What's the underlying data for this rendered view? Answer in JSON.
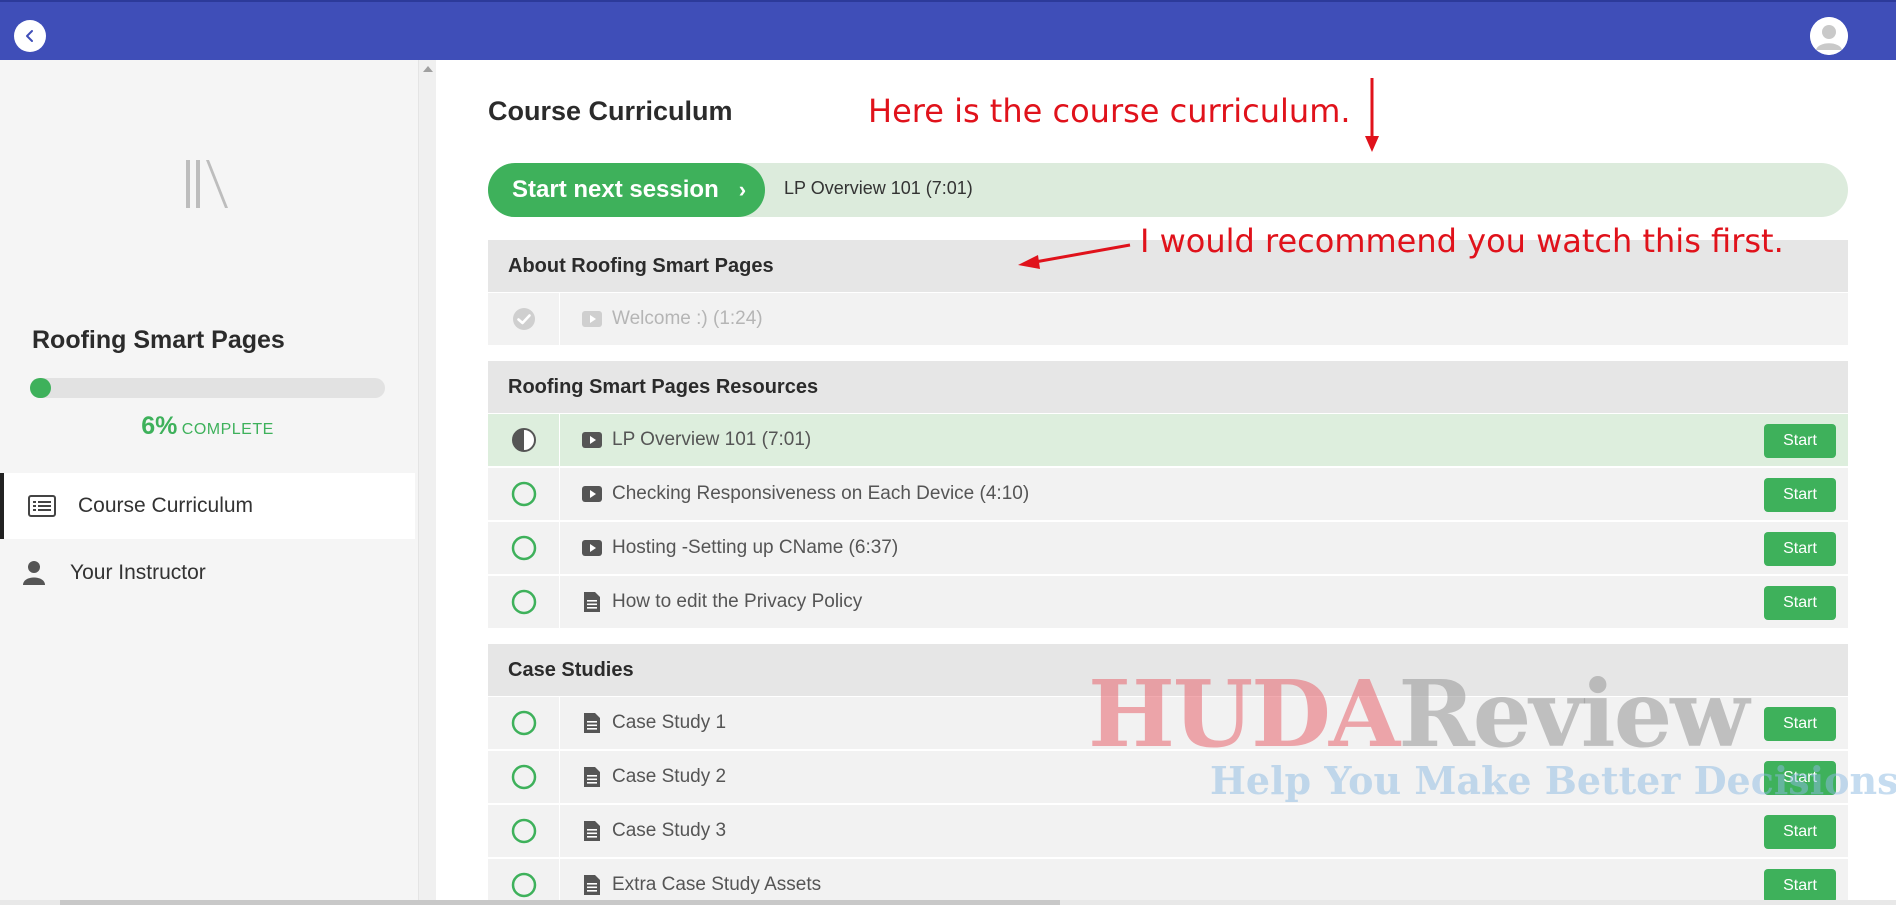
{
  "header": {
    "back_icon": "chevron-left-icon",
    "avatar_icon": "user-avatar-icon",
    "colors": {
      "bar": "#3f4eb8"
    }
  },
  "sidebar": {
    "logo_icon": "library-icon",
    "course_title": "Roofing Smart Pages",
    "progress": {
      "percent_label": "6%",
      "complete_label": "COMPLETE",
      "fraction": 0.06
    },
    "nav": [
      {
        "label": "Course Curriculum",
        "icon": "list-icon",
        "active": true
      },
      {
        "label": "Your Instructor",
        "icon": "person-icon",
        "active": false
      }
    ]
  },
  "main": {
    "title": "Course Curriculum",
    "next_session": {
      "button_label": "Start next session",
      "chevron": "›",
      "lesson": "LP Overview 101 (7:01)"
    },
    "sections": [
      {
        "title": "About Roofing Smart Pages",
        "lessons": [
          {
            "title": "Welcome :) (1:24)",
            "type": "video",
            "status": "completed",
            "button": ""
          }
        ]
      },
      {
        "title": "Roofing Smart Pages Resources",
        "lessons": [
          {
            "title": "LP Overview 101 (7:01)",
            "type": "video",
            "status": "in-progress",
            "button": "Start"
          },
          {
            "title": "Checking Responsiveness on Each Device (4:10)",
            "type": "video",
            "status": "not-started",
            "button": "Start"
          },
          {
            "title": "Hosting -Setting up CName (6:37)",
            "type": "video",
            "status": "not-started",
            "button": "Start"
          },
          {
            "title": "How to edit the Privacy Policy",
            "type": "text",
            "status": "not-started",
            "button": "Start"
          }
        ]
      },
      {
        "title": "Case Studies",
        "lessons": [
          {
            "title": "Case Study 1",
            "type": "text",
            "status": "not-started",
            "button": "Start"
          },
          {
            "title": "Case Study 2",
            "type": "text",
            "status": "not-started",
            "button": "Start"
          },
          {
            "title": "Case Study 3",
            "type": "text",
            "status": "not-started",
            "button": "Start"
          },
          {
            "title": "Extra Case Study Assets",
            "type": "text",
            "status": "not-started",
            "button": "Start"
          }
        ]
      }
    ]
  },
  "annotations": {
    "note_1": "Here is the course curriculum.",
    "note_2": "I would recommend you watch this first."
  },
  "watermark": {
    "part_a": "HUDA",
    "part_b": "Review",
    "tagline": "Help You Make Better Decisions"
  },
  "colors": {
    "accent": "#3eb15b",
    "annotation": "#e0121b",
    "current_row": "#ddeedd"
  }
}
